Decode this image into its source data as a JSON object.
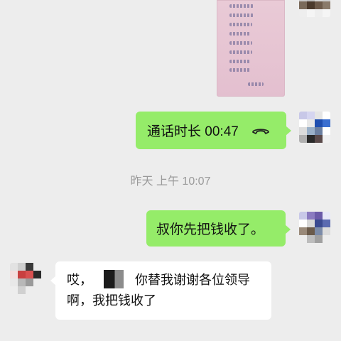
{
  "chat": {
    "call_message": {
      "label": "通话时长 00:47",
      "icon": "hang-up-icon"
    },
    "timestamp": "昨天 上午 10:07",
    "outgoing_text": "叔你先把钱收了。",
    "incoming_reply": {
      "before_redaction": "哎，",
      "after_redaction": "你替我谢谢各位领导啊，我把钱收了"
    }
  },
  "colors": {
    "background": "#ededed",
    "sent_bubble": "#95ec69",
    "received_bubble": "#ffffff",
    "timestamp_text": "#9a9a9a",
    "photo_paper": "#e6c4d2"
  }
}
